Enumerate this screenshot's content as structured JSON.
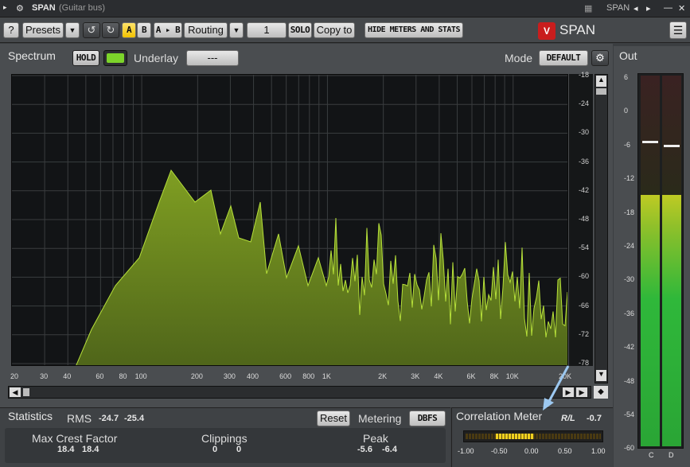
{
  "title": {
    "app": "SPAN",
    "subtitle": "(Guitar bus)",
    "right_label": "SPAN"
  },
  "toolbar": {
    "help": "?",
    "presets": "Presets",
    "a": "A",
    "b": "B",
    "ab": "A ▸ B",
    "routing": "Routing",
    "channel": "1",
    "solo": "SOLO",
    "copy_to": "Copy to",
    "hide_meters": "HIDE METERS AND STATS",
    "logo": "SPAN"
  },
  "spectrum": {
    "label": "Spectrum",
    "hold": "HOLD",
    "underlay_label": "Underlay",
    "underlay_value": "---",
    "mode_label": "Mode",
    "mode_value": "DEFAULT",
    "db_ticks": [
      "-18",
      "-24",
      "-30",
      "-36",
      "-42",
      "-48",
      "-54",
      "-60",
      "-66",
      "-72",
      "-78"
    ],
    "freq_ticks": [
      "20",
      "30",
      "40",
      "60",
      "80",
      "100",
      "200",
      "300",
      "400",
      "600",
      "800",
      "1K",
      "2K",
      "3K",
      "4K",
      "6K",
      "8K",
      "10K",
      "20K"
    ]
  },
  "out": {
    "label": "Out",
    "ticks": [
      "6",
      "0",
      "-6",
      "-12",
      "-18",
      "-24",
      "-30",
      "-36",
      "-42",
      "-48",
      "-54",
      "-60"
    ],
    "channels": [
      "C",
      "D"
    ],
    "level_fraction": [
      0.72,
      0.72
    ]
  },
  "stats": {
    "label": "Statistics",
    "rms_label": "RMS",
    "rms_l": "-24.7",
    "rms_r": "-25.4",
    "reset": "Reset",
    "metering_label": "Metering",
    "metering_value": "DBFS",
    "crest_label": "Max Crest Factor",
    "crest_l": "18.4",
    "crest_r": "18.4",
    "clip_label": "Clippings",
    "clip_l": "0",
    "clip_r": "0",
    "peak_label": "Peak",
    "peak_l": "-5.6",
    "peak_r": "-6.4"
  },
  "correlation": {
    "label": "Correlation Meter",
    "rl_label": "R/L",
    "rl_value": "-0.7",
    "ticks": [
      "-1.00",
      "-0.50",
      "0.00",
      "0.50",
      "1.00"
    ]
  },
  "colors": {
    "accent": "#f2c200",
    "spectrum_fill": "#6e8a1e",
    "spectrum_line": "#b6e03a",
    "meter_green": "#2fb83a",
    "meter_yellow": "#d8d020"
  }
}
